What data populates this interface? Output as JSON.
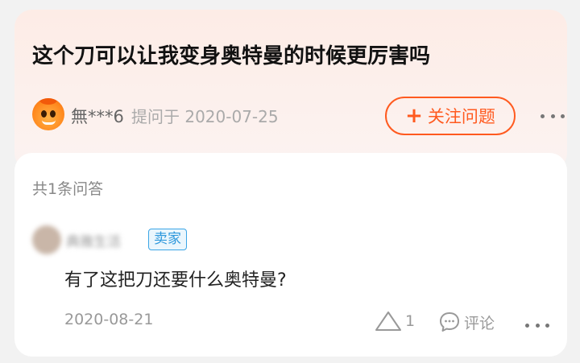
{
  "question": {
    "title": "这个刀可以让我变身奥特曼的时候更厉害吗",
    "asker_name": "無***6",
    "asked_at": "提问于 2020-07-25",
    "follow_button": {
      "icon": "plus-icon",
      "label": "关注问题"
    },
    "more_icon": "more-icon"
  },
  "answers": {
    "count_label": "共1条问答",
    "items": [
      {
        "author_name": "典雅生活",
        "badge": "卖家",
        "text": "有了这把刀还要什么奥特曼?",
        "date": "2020-08-21",
        "likes": "1",
        "comment_label": "评论"
      }
    ]
  },
  "colors": {
    "accent": "#ff5a1f",
    "badge_blue": "#2e98dc",
    "card_tint": "#fdece6"
  }
}
